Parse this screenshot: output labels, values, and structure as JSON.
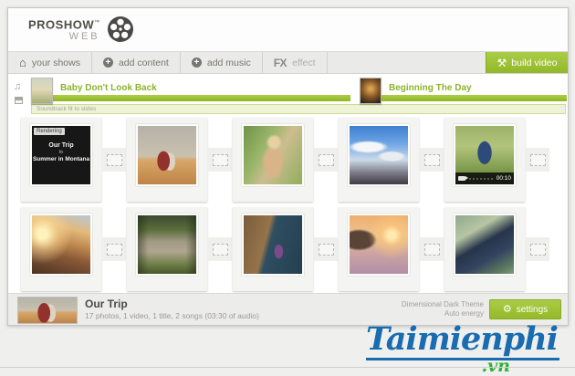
{
  "app": {
    "logo_top": "PROSHOW",
    "logo_tm": "™",
    "logo_sub": "WEB"
  },
  "toolbar": {
    "items": [
      {
        "icon": "home-icon",
        "label": "your shows"
      },
      {
        "icon": "plus-icon",
        "label": "add content"
      },
      {
        "icon": "plus-icon",
        "label": "add music"
      },
      {
        "prefix": "FX",
        "label": "effect"
      }
    ],
    "build_label": "build video"
  },
  "soundtrack": {
    "tracks": [
      {
        "title": "Baby Don't Look Back"
      },
      {
        "title": "Beginning The Day"
      }
    ],
    "timing_label": "Soundtrack fit to slides"
  },
  "filmstrip": {
    "rendering_badge": "Rendering",
    "title_slide": {
      "line1": "Our Trip",
      "line2": "to",
      "line3": "Summer in Montana"
    },
    "rows": [
      [
        {
          "kind": "title",
          "photo": "title-dark"
        },
        {
          "kind": "photo",
          "photo": "beach-couple"
        },
        {
          "kind": "photo",
          "photo": "blonde-woman"
        },
        {
          "kind": "photo",
          "photo": "mountain-sky"
        },
        {
          "kind": "video",
          "photo": "hiker-video",
          "duration": "00:10"
        }
      ],
      [
        {
          "kind": "photo",
          "photo": "sunset-mountains"
        },
        {
          "kind": "photo",
          "photo": "stone-pier"
        },
        {
          "kind": "photo",
          "photo": "cliff-sitter"
        },
        {
          "kind": "photo",
          "photo": "sea-sunset"
        },
        {
          "kind": "photo",
          "photo": "sneaker"
        }
      ]
    ]
  },
  "footer": {
    "show_title": "Our Trip",
    "show_details": "17 photos, 1 video, 1 title, 2 songs (03:30 of audio)",
    "theme_name": "Dimensional Dark Theme",
    "theme_energy": "Auto energy",
    "settings_label": "settings"
  },
  "watermark": {
    "name": "Taimienphi",
    "tld": ".vn"
  },
  "colors": {
    "accent_green": "#9bc226",
    "watermark_blue": "#1a6cb0",
    "watermark_green": "#2eb135"
  }
}
